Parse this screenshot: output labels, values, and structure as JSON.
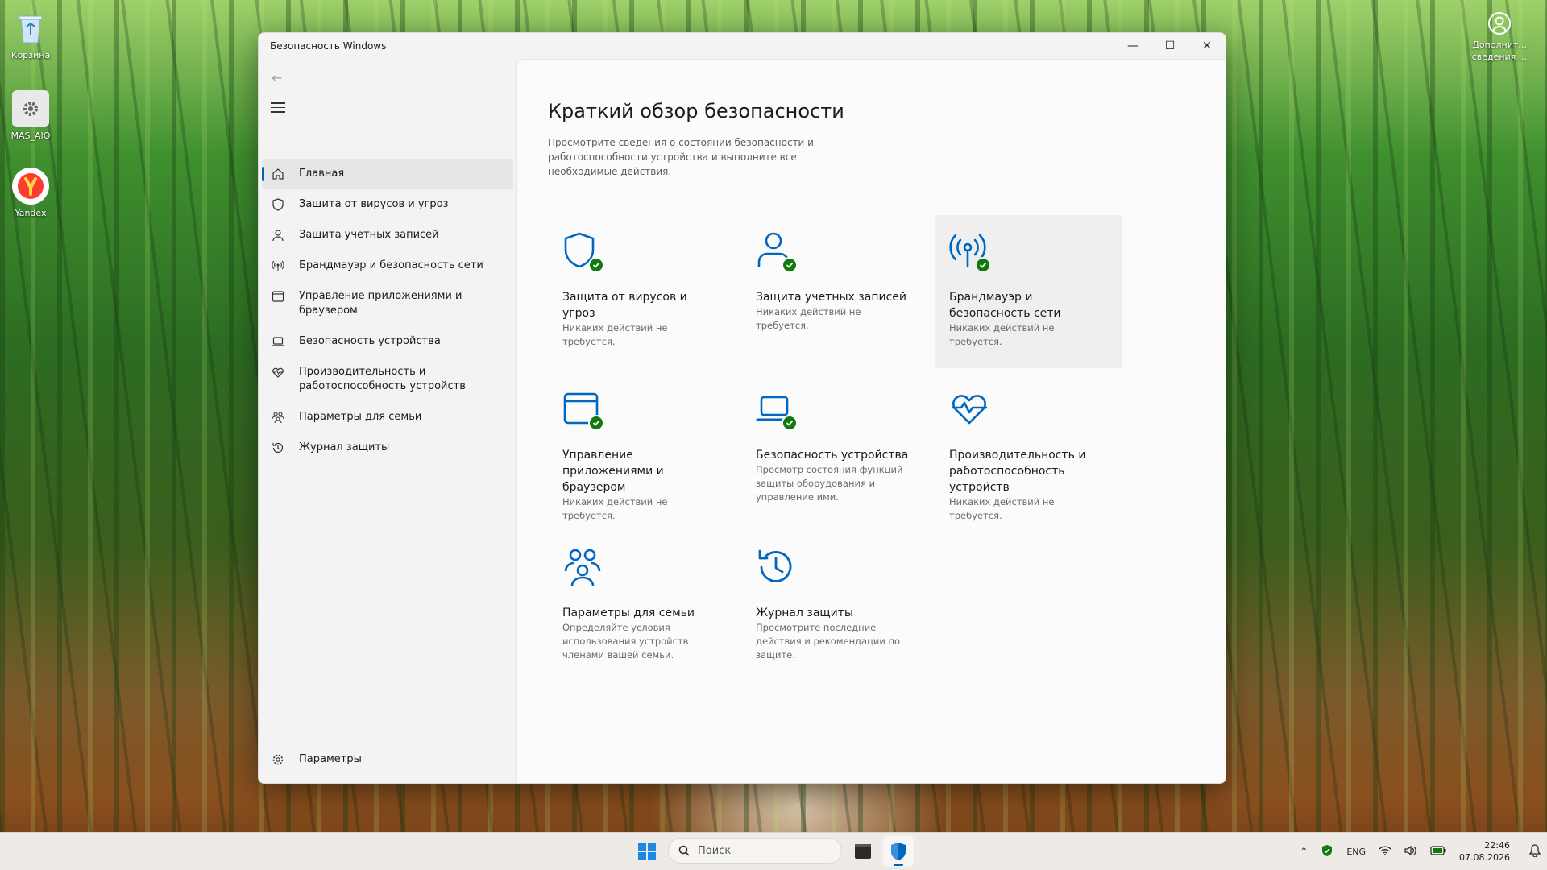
{
  "desktop": {
    "icons": [
      {
        "label": "Корзина"
      },
      {
        "label": "MAS_AIO"
      },
      {
        "label": "Yandex"
      }
    ],
    "top_right_label": "Дополнит... сведения ..."
  },
  "window": {
    "title": "Безопасность Windows",
    "controls": {
      "minimize": "—",
      "maximize": "☐",
      "close": "✕"
    }
  },
  "sidebar": {
    "items": [
      {
        "label": "Главная",
        "icon": "home-icon",
        "active": true
      },
      {
        "label": "Защита от вирусов и угроз",
        "icon": "shield-icon"
      },
      {
        "label": "Защита учетных записей",
        "icon": "person-icon"
      },
      {
        "label": "Брандмауэр и безопасность сети",
        "icon": "antenna-icon"
      },
      {
        "label": "Управление приложениями и браузером",
        "icon": "app-browser-icon"
      },
      {
        "label": "Безопасность устройства",
        "icon": "laptop-icon"
      },
      {
        "label": "Производительность и работоспособность устройств",
        "icon": "heart-pulse-icon"
      },
      {
        "label": "Параметры для семьи",
        "icon": "family-icon"
      },
      {
        "label": "Журнал защиты",
        "icon": "history-icon"
      }
    ],
    "settings_label": "Параметры"
  },
  "main": {
    "title": "Краткий обзор безопасности",
    "description": "Просмотрите сведения о состоянии безопасности и работоспособности устройства и выполните все необходимые действия.",
    "tiles": [
      {
        "title": "Защита от вирусов и угроз",
        "subtitle": "Никаких действий не требуется.",
        "icon": "shield-icon",
        "ok": true
      },
      {
        "title": "Защита учетных записей",
        "subtitle": "Никаких действий не требуется.",
        "icon": "person-icon",
        "ok": true
      },
      {
        "title": "Брандмауэр и безопасность сети",
        "subtitle": "Никаких действий не требуется.",
        "icon": "antenna-icon",
        "ok": true
      },
      {
        "title": "Управление приложениями и браузером",
        "subtitle": "Никаких действий не требуется.",
        "icon": "app-browser-icon",
        "ok": true
      },
      {
        "title": "Безопасность устройства",
        "subtitle": "Просмотр состояния функций защиты оборудования и управление ими.",
        "icon": "laptop-icon",
        "ok": true
      },
      {
        "title": "Производительность и работоспособность устройств",
        "subtitle": "Никаких действий не требуется.",
        "icon": "heart-pulse-icon",
        "ok": false
      },
      {
        "title": "Параметры для семьи",
        "subtitle": "Определяйте условия использования устройств членами вашей семьи.",
        "icon": "family-icon",
        "ok": false
      },
      {
        "title": "Журнал защиты",
        "subtitle": "Просмотрите последние действия и рекомендации по защите.",
        "icon": "history-icon",
        "ok": false
      }
    ]
  },
  "taskbar": {
    "search_placeholder": "Поиск",
    "language": "ENG",
    "time": "22:46",
    "date": "07.08.2026"
  },
  "colors": {
    "accent": "#005fb8",
    "ok_green": "#0f7b0f",
    "icon_blue": "#0067c0"
  }
}
